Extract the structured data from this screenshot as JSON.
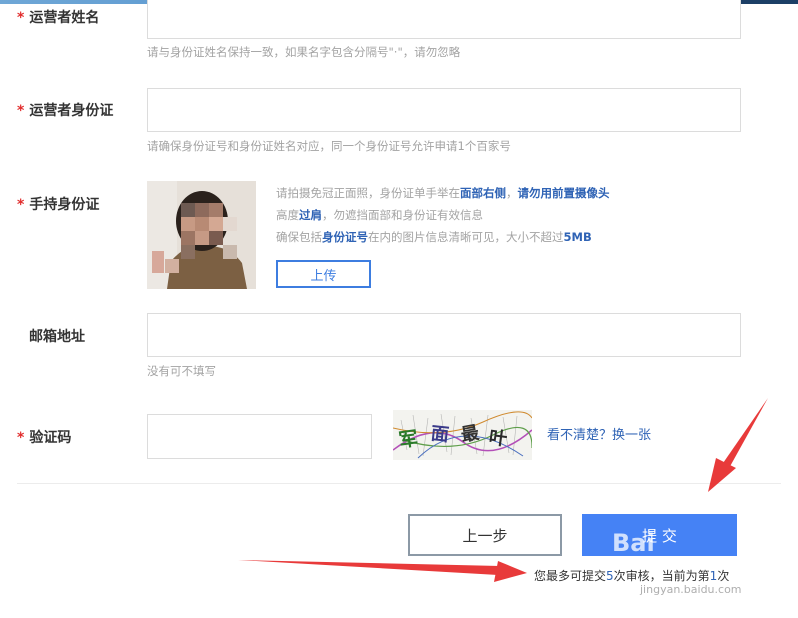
{
  "form": {
    "operator_name": {
      "required_mark": "*",
      "label": "运营者姓名",
      "hint": "请与身份证姓名保持一致，如果名字包含分隔号\"·\"，请勿忽略"
    },
    "operator_id": {
      "required_mark": "*",
      "label": "运营者身份证",
      "hint": "请确保身份证号和身份证姓名对应，同一个身份证号允许申请1个百家号"
    },
    "handheld_id": {
      "required_mark": "*",
      "label": "手持身份证",
      "hints": {
        "line1_a": "请拍摄免冠正面照，身份证单手举在",
        "line1_b": "面部右侧",
        "line1_c": "，",
        "line1_d": "请勿用前置摄像头",
        "line2_a": "高度",
        "line2_b": "过肩",
        "line2_c": "，勿遮挡面部和身份证有效信息",
        "line3_a": "确保包括",
        "line3_b": "身份证号",
        "line3_c": "在内的图片信息清晰可见，大小不超过",
        "line3_d": "5MB"
      },
      "upload_label": "上传"
    },
    "email": {
      "label": "邮箱地址",
      "hint": "没有可不填写"
    },
    "captcha": {
      "required_mark": "*",
      "label": "验证码",
      "image_text": [
        "军",
        "面",
        "最",
        "叶"
      ],
      "refresh_label": "看不清楚？换一张"
    }
  },
  "actions": {
    "prev_label": "上一步",
    "submit_label": "提 交",
    "notice_a": "您最多可提交",
    "notice_max": "5",
    "notice_b": "次审核，当前为第",
    "notice_cur": "1",
    "notice_c": "次"
  },
  "watermark": {
    "brand": "Bai",
    "domain": "jingyan.baidu.com"
  },
  "colors": {
    "accent": "#4582f5",
    "required": "#e12c2c",
    "link": "#2f63b5",
    "annotation_arrow": "#e83a3a"
  }
}
